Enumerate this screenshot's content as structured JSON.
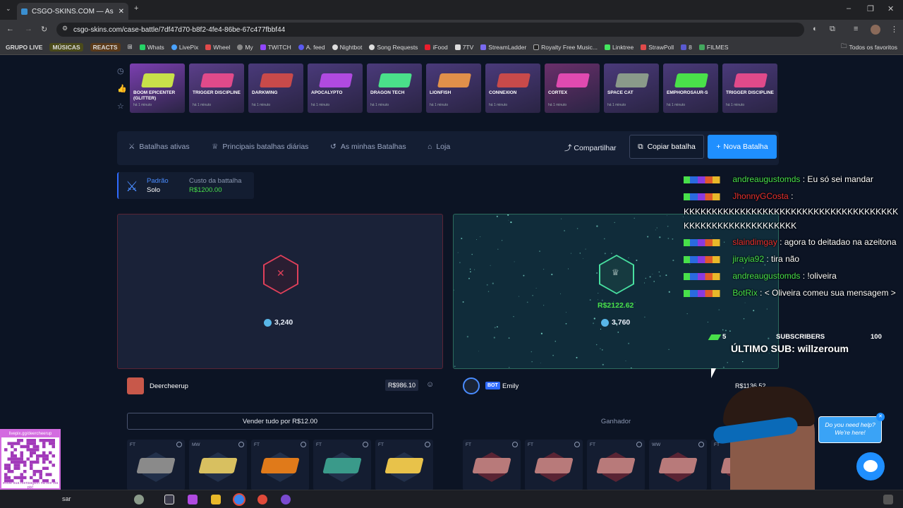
{
  "browser": {
    "tab_title": "CSGO-SKINS.COM — As melho",
    "url": "csgo-skins.com/case-battle/7df47d70-b8f2-4fe4-86be-67c477fbbf44",
    "bookmarks": [
      "GRUPO LIVE",
      "MÚSICAS",
      "REACTS",
      "Whats",
      "LivePix",
      "Wheel",
      "My",
      "TWITCH",
      "A. feed",
      "Nightbot",
      "Song Requests",
      "iFood",
      "7TV",
      "StreamLadder",
      "Royalty Free Music...",
      "Linktree",
      "StrawPoll",
      "8",
      "FILMES"
    ],
    "all_bookmarks": "Todos os favoritos"
  },
  "live_drops": [
    {
      "name": "BOOM EPICENTER (GLITTER)",
      "time": "há 1 minuto",
      "color": "#7b3fb0"
    },
    {
      "name": "TRIGGER DISCIPLINE",
      "time": "há 1 minuto",
      "color": "#5b3f8a"
    },
    {
      "name": "DARKWING",
      "time": "há 1 minuto",
      "color": "#4a3a7a"
    },
    {
      "name": "APOCALYPTO",
      "time": "há 1 minuto",
      "color": "#4a3a7a"
    },
    {
      "name": "DRAGON TECH",
      "time": "há 1 minuto",
      "color": "#4a3a7a"
    },
    {
      "name": "LIONFISH",
      "time": "há 1 minuto",
      "color": "#4a3a7a"
    },
    {
      "name": "CONNEXION",
      "time": "há 1 minuto",
      "color": "#4a3a7a"
    },
    {
      "name": "CORTEX",
      "time": "há 1 minuto",
      "color": "#6a2f6a"
    },
    {
      "name": "SPACE CAT",
      "time": "há 1 minuto",
      "color": "#4a3a7a"
    },
    {
      "name": "EMPHOROSAUR-S",
      "time": "há 1 minuto",
      "color": "#4a3a7a"
    },
    {
      "name": "TRIGGER DISCIPLINE",
      "time": "há 1 minuto",
      "color": "#4a3a7a"
    }
  ],
  "nav": {
    "active_battles": "Batalhas ativas",
    "top_daily": "Principais batalhas diárias",
    "my_battles": "As minhas Batalhas",
    "shop": "Loja",
    "share": "Compartilhar",
    "copy": "Copiar batalha",
    "new": "Nova Batalha"
  },
  "mode": {
    "label": "Padrão",
    "value": "Solo",
    "cost_label": "Custo da battalha",
    "cost": "R$1200.00"
  },
  "player_left": {
    "coins": "3,240",
    "name": "Deercheerup",
    "total": "R$986.10",
    "sell_label": "Vender tudo por R$12.00",
    "items": [
      {
        "q": "FT",
        "color": "#8a8a8a"
      },
      {
        "q": "MW",
        "color": "#d8c060"
      },
      {
        "q": "FT",
        "color": "#e07a1a"
      },
      {
        "q": "FT",
        "color": "#3a9a8a"
      },
      {
        "q": "FT",
        "color": "#e8c24a"
      }
    ]
  },
  "player_right": {
    "coins": "3,760",
    "win_amount": "R$2122.62",
    "name": "Emily",
    "bot_tag": "BOT",
    "total": "R$1136.52",
    "winner_label": "Ganhador",
    "items": [
      {
        "q": "FT"
      },
      {
        "q": "FT"
      },
      {
        "q": "FT"
      },
      {
        "q": "WW"
      },
      {
        "q": "FT"
      }
    ]
  },
  "chat": [
    {
      "user": "andreaugustomds",
      "color": "#48e04a",
      "msg": ": Eu só sei mandar"
    },
    {
      "user": "JhonnyGCosta",
      "color": "#e8302e",
      "msg": ":"
    },
    {
      "user": "",
      "color": "#fff",
      "msg": "KKKKKKKKKKKKKKKKKKKKKKKKKKKKKKKKKKKKKK"
    },
    {
      "user": "",
      "color": "#fff",
      "msg": "KKKKKKKKKKKKKKKKKKKK"
    },
    {
      "user": "slaindimgay",
      "color": "#e8302e",
      "msg": ": agora to deitadao na azeitona"
    },
    {
      "user": "jirayia92",
      "color": "#48e04a",
      "msg": ": tira não"
    },
    {
      "user": "andreaugustomds",
      "color": "#48e04a",
      "msg": ": !oliveira"
    },
    {
      "user": "BotRix",
      "color": "#48e04a",
      "msg": ": < Oliveira comeu sua mensagem >"
    }
  ],
  "subs": {
    "count": "5",
    "label": "SUBSCRIBERS",
    "goal": "100",
    "last_sub": "ÚLTIMO SUB: willzeroum"
  },
  "help": {
    "line1": "Do you need help?",
    "line2": "We're here!"
  },
  "qr_caption": "livepix.gg/deercheerup",
  "qr_footer": "envie sua mensagem na live via pix!",
  "taskbar": {
    "search": "sar"
  }
}
